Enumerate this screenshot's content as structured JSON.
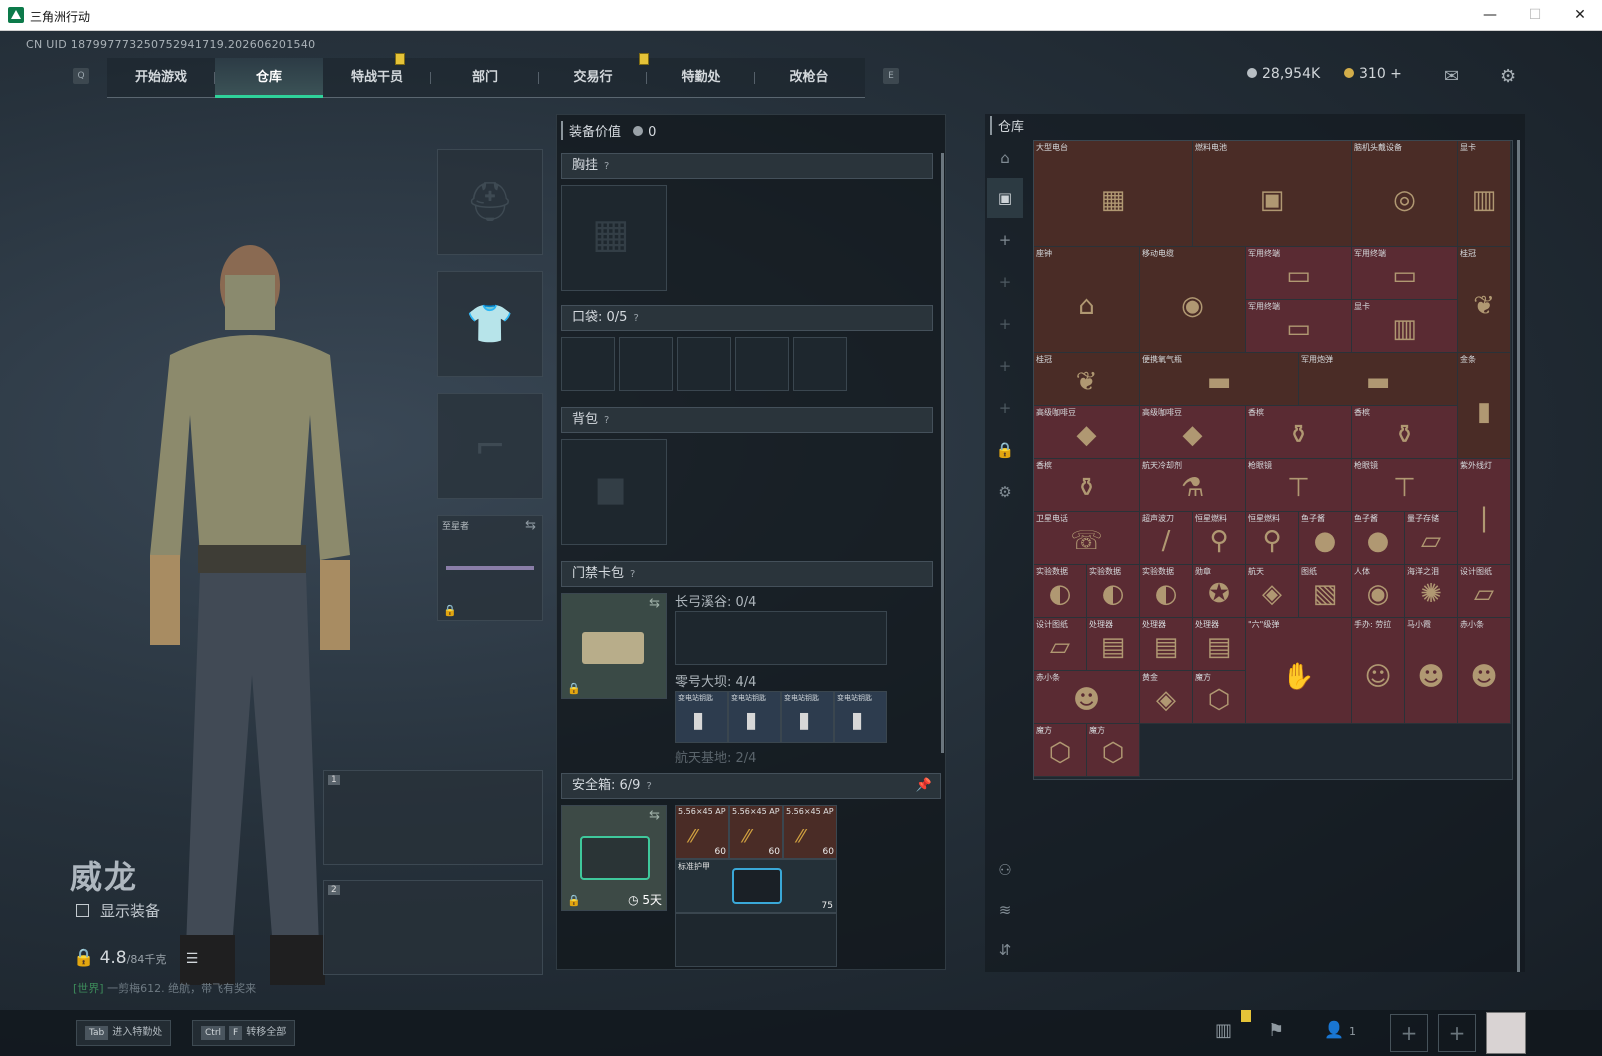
{
  "window": {
    "title": "三角洲行动",
    "min": "—",
    "max": "☐",
    "close": "✕"
  },
  "uid": "CN UID 18799777325075294171​9.202606201540",
  "nav": {
    "left_key": "Q",
    "right_key": "E",
    "tabs": [
      "开始游戏",
      "仓库",
      "特战干员",
      "部门",
      "交易行",
      "特勤处",
      "改枪台"
    ],
    "active": "仓库"
  },
  "currency": {
    "silver": "28,954K",
    "gold": "310 +"
  },
  "character": {
    "name": "威龙",
    "show_equipment": "显示装备",
    "weight": "4.8",
    "weight_max": "/84千克"
  },
  "melee": {
    "label": "至星者"
  },
  "weapon_slots": [
    "1",
    "2"
  ],
  "chat": {
    "channel": "[世界]",
    "text": "一剪梅612. 绝航，带飞有奖来"
  },
  "bottom": {
    "tab_key": "Tab",
    "tab_label": "进入特勤处",
    "ctrl_key": "Ctrl",
    "f_key": "F",
    "transfer_label": "转移全部",
    "friends": "1"
  },
  "equipment": {
    "value_label": "装备价值",
    "value": "0",
    "chest": "胸挂",
    "pocket": "口袋: ",
    "pocket_count": "0/5",
    "backpack": "背包",
    "keycard": "门禁卡包",
    "key_sections": [
      {
        "name": "长弓溪谷: 0/4"
      },
      {
        "name": "零号大坝: 4/4",
        "items": [
          "变电站钥匙",
          "变电站钥匙",
          "变电站钥匙",
          "变电站钥匙"
        ]
      },
      {
        "name": "航天基地: 2/4"
      }
    ],
    "safe_box": "安全箱: ",
    "safe_count": "6/9",
    "safe_timer": "5天",
    "safe_items": [
      {
        "name": "5.56×45 AP",
        "qty": "60"
      },
      {
        "name": "5.56×45 AP",
        "qty": "60"
      },
      {
        "name": "5.56×45 AP",
        "qty": "60"
      }
    ],
    "armor": {
      "name": "标准护甲",
      "durability": "75"
    }
  },
  "storage": {
    "title": "仓库",
    "items": [
      {
        "name": "大型电台",
        "color": "brown"
      },
      {
        "name": "燃料电池",
        "color": "brown"
      },
      {
        "name": "脑机头戴设备",
        "color": "brown"
      },
      {
        "name": "显卡",
        "color": "brown"
      },
      {
        "name": "座钟",
        "color": "brown"
      },
      {
        "name": "移动电缆",
        "color": "brown"
      },
      {
        "name": "军用终端",
        "color": "red"
      },
      {
        "name": "军用终端",
        "color": "red"
      },
      {
        "name": "军用终端",
        "color": "red"
      },
      {
        "name": "显卡",
        "color": "red"
      },
      {
        "name": "桂冠",
        "color": "brown"
      },
      {
        "name": "桂冠",
        "color": "brown"
      },
      {
        "name": "便携氧气瓶",
        "color": "brown"
      },
      {
        "name": "军用炮弹",
        "color": "brown"
      },
      {
        "name": "金条",
        "color": "brown"
      },
      {
        "name": "高级咖啡豆",
        "color": "red"
      },
      {
        "name": "高级咖啡豆",
        "color": "red"
      },
      {
        "name": "香槟",
        "color": "red"
      },
      {
        "name": "香槟",
        "color": "red"
      },
      {
        "name": "香槟",
        "color": "red"
      },
      {
        "name": "航天冷却剂",
        "color": "red"
      },
      {
        "name": "枪眼镜",
        "color": "red"
      },
      {
        "name": "枪眼镜",
        "color": "red"
      },
      {
        "name": "紫外线灯",
        "color": "red"
      },
      {
        "name": "卫星电话",
        "color": "red"
      },
      {
        "name": "超声波刀",
        "color": "red"
      },
      {
        "name": "恒星燃料",
        "color": "red"
      },
      {
        "name": "恒星燃料",
        "color": "red"
      },
      {
        "name": "鱼子酱",
        "color": "red"
      },
      {
        "name": "鱼子酱",
        "color": "red"
      },
      {
        "name": "量子存储",
        "color": "red"
      },
      {
        "name": "实验数据",
        "color": "red"
      },
      {
        "name": "实验数据",
        "color": "red"
      },
      {
        "name": "实验数据",
        "color": "red"
      },
      {
        "name": "勋章",
        "color": "red"
      },
      {
        "name": "航天",
        "color": "red"
      },
      {
        "name": "图纸",
        "color": "red"
      },
      {
        "name": "人体",
        "color": "red"
      },
      {
        "name": "海洋之泪",
        "color": "red"
      },
      {
        "name": "设计图纸",
        "color": "red"
      },
      {
        "name": "设计图纸",
        "color": "red"
      },
      {
        "name": "处理器",
        "color": "red"
      },
      {
        "name": "处理器",
        "color": "red"
      },
      {
        "name": "处理器",
        "color": "red"
      },
      {
        "name": "\"六\"级弹",
        "color": "red"
      },
      {
        "name": "手办: 劳拉",
        "color": "red"
      },
      {
        "name": "马小霞",
        "color": "red"
      },
      {
        "name": "赤小条",
        "color": "red"
      },
      {
        "name": "赤小条",
        "color": "red"
      },
      {
        "name": "黄金",
        "color": "red"
      },
      {
        "name": "魔方",
        "color": "red"
      },
      {
        "name": "魔方",
        "color": "red"
      },
      {
        "name": "魔方",
        "color": "red"
      }
    ]
  },
  "colors": {
    "accent": "#2fd29a",
    "brown": "#4a2c26",
    "red": "#5a2b33"
  }
}
